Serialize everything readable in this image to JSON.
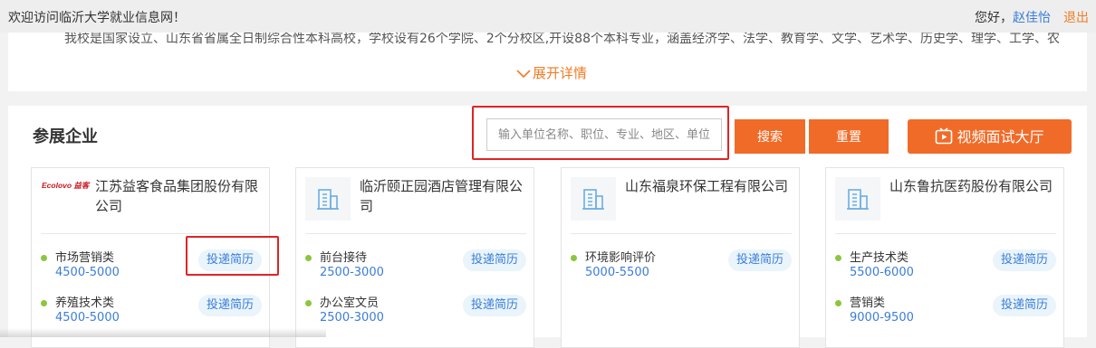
{
  "topbar": {
    "welcome": "欢迎访问临沂大学就业信息网！",
    "greeting": "您好，",
    "user": "赵佳怡",
    "logout": "退出"
  },
  "intro": {
    "text": "我校是国家设立、山东省省属全日制综合性本科高校，学校设有26个学院、2个分校区,开设88个本科专业，涵盖经济学、法学、教育学、文学、艺术学、历史学、理学、工学、农",
    "expand": "展开详情"
  },
  "exhibitors": {
    "title": "参展企业",
    "search_placeholder": "输入单位名称、职位、专业、地区、单位",
    "search_btn": "搜索",
    "reset_btn": "重置",
    "video_btn": "视频面试大厅"
  },
  "companies": [
    {
      "name": "江苏益客食品集团股份有限公司",
      "logo": "Ecolovo 益客",
      "jobs": [
        {
          "title": "市场营销类",
          "salary": "4500-5000",
          "apply": "投递简历"
        },
        {
          "title": "养殖技术类",
          "salary": "4500-5000",
          "apply": "投递简历"
        }
      ]
    },
    {
      "name": "临沂颐正园酒店管理有限公司",
      "logo": "building-icon",
      "jobs": [
        {
          "title": "前台接待",
          "salary": "2500-3000",
          "apply": "投递简历"
        },
        {
          "title": "办公室文员",
          "salary": "2500-3000",
          "apply": "投递简历"
        }
      ]
    },
    {
      "name": "山东福泉环保工程有限公司",
      "logo": "building-icon",
      "jobs": [
        {
          "title": "环境影响评价",
          "salary": "5000-5500",
          "apply": "投递简历"
        }
      ]
    },
    {
      "name": "山东鲁抗医药股份有限公司",
      "logo": "building-icon",
      "jobs": [
        {
          "title": "生产技术类",
          "salary": "5500-6000",
          "apply": "投递简历"
        },
        {
          "title": "营销类",
          "salary": "9000-9500",
          "apply": "投递简历"
        }
      ]
    }
  ],
  "colors": {
    "accent": "#f06b28",
    "link": "#3b7dd8",
    "highlight": "#e02424",
    "dot": "#8cc63e"
  }
}
